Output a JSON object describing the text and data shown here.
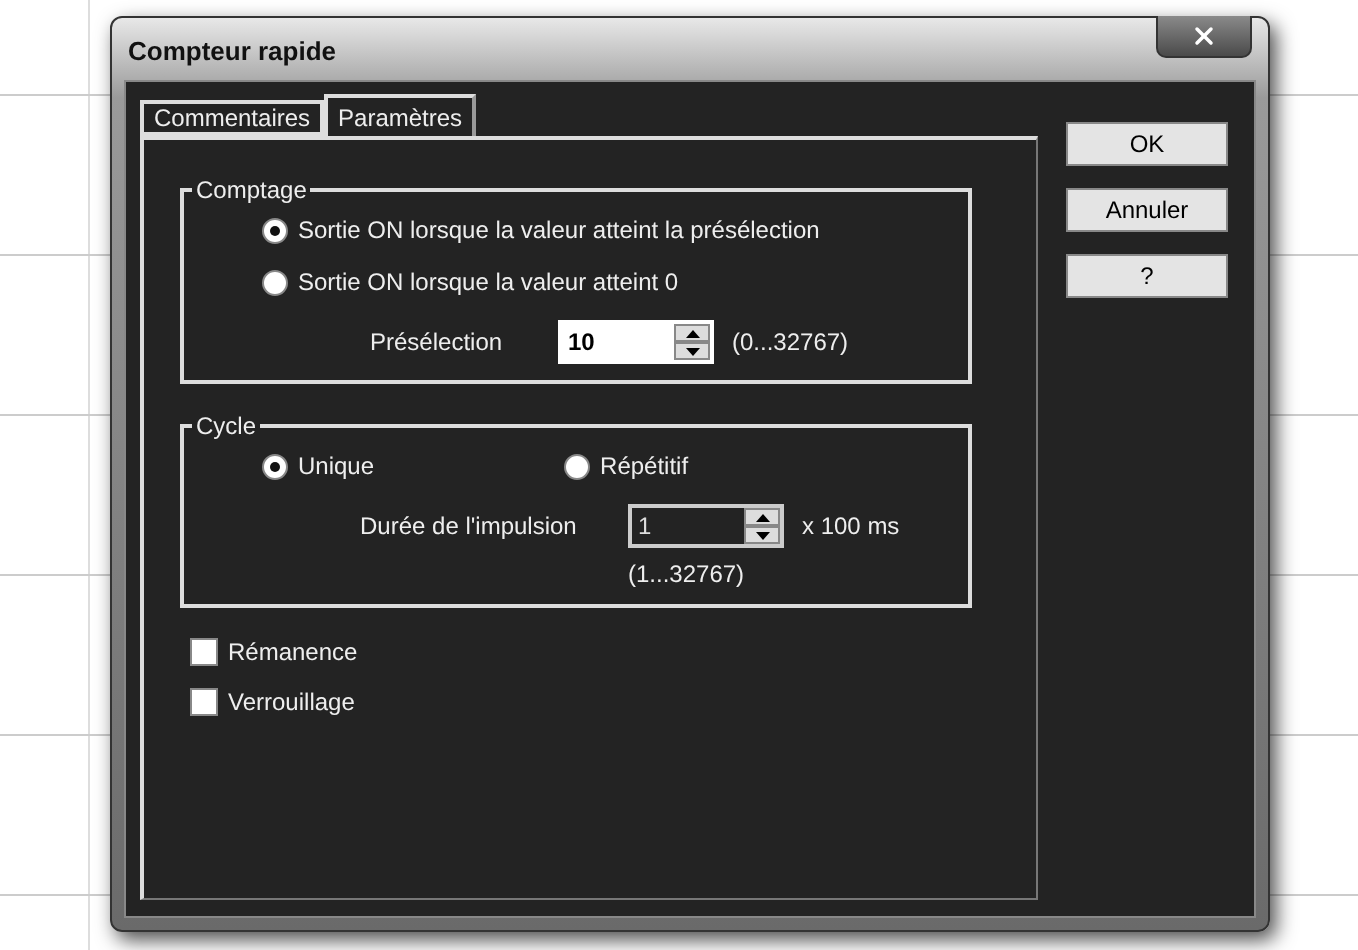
{
  "window": {
    "title": "Compteur rapide"
  },
  "tabs": [
    {
      "label": "Commentaires",
      "selected": false
    },
    {
      "label": "Paramètres",
      "selected": true
    }
  ],
  "comptage": {
    "title": "Comptage",
    "options": [
      {
        "label": "Sortie ON lorsque la valeur atteint la présélection",
        "selected": true
      },
      {
        "label": "Sortie ON lorsque la valeur atteint 0",
        "selected": false
      }
    ],
    "field": {
      "label": "Présélection",
      "value": "10",
      "range": "(0...32767)",
      "disabled": false
    }
  },
  "cycle": {
    "title": "Cycle",
    "options": [
      {
        "label": "Unique",
        "selected": true
      },
      {
        "label": "Répétitif",
        "selected": false
      }
    ],
    "field": {
      "label": "Durée de l'impulsion",
      "value": "1",
      "unit": "x 100 ms",
      "range": "(1...32767)",
      "disabled": true
    }
  },
  "checkboxes": [
    {
      "label": "Rémanence",
      "checked": false
    },
    {
      "label": "Verrouillage",
      "checked": false
    }
  ],
  "buttons": [
    "OK",
    "Annuler",
    "?"
  ]
}
